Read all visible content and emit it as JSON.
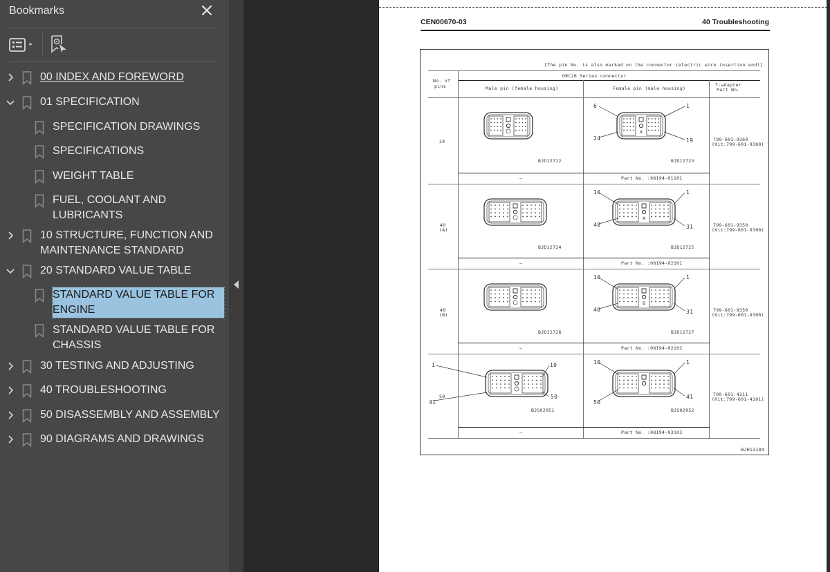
{
  "sidebar": {
    "title": "Bookmarks",
    "close_icon": "close-icon",
    "toolbar": {
      "options_icon": "list-options-icon",
      "find_icon": "find-current-bookmark-icon"
    },
    "items": [
      {
        "label": "00 INDEX AND FOREWORD",
        "level": 0,
        "expanded": false,
        "underline": true
      },
      {
        "label": "01 SPECIFICATION",
        "level": 0,
        "expanded": true
      },
      {
        "label": "SPECIFICATION DRAWINGS",
        "level": 1
      },
      {
        "label": "SPECIFICATIONS",
        "level": 1
      },
      {
        "label": "WEIGHT TABLE",
        "level": 1
      },
      {
        "label": "FUEL, COOLANT AND LUBRICANTS",
        "level": 1
      },
      {
        "label": "10 STRUCTURE, FUNCTION AND MAINTENANCE STANDARD",
        "level": 0,
        "expanded": false
      },
      {
        "label": "20 STANDARD VALUE TABLE",
        "level": 0,
        "expanded": true
      },
      {
        "label": "STANDARD VALUE TABLE FOR ENGINE",
        "level": 1,
        "selected": true
      },
      {
        "label": "STANDARD VALUE TABLE FOR CHASSIS",
        "level": 1
      },
      {
        "label": "30 TESTING AND ADJUSTING",
        "level": 0,
        "expanded": false
      },
      {
        "label": "40 TROUBLESHOOTING",
        "level": 0,
        "expanded": false
      },
      {
        "label": "50 DISASSEMBLY AND ASSEMBLY",
        "level": 0,
        "expanded": false
      },
      {
        "label": "90 DIAGRAMS AND DRAWINGS",
        "level": 0,
        "expanded": false
      }
    ],
    "selection_color": "#9ac3e0"
  },
  "document": {
    "header_left": "CEN00670-03",
    "header_right": "40 Troubleshooting",
    "figure": {
      "note": "[The pin No. is also marked on the connector (electric wire insertion end)]",
      "series_header": "DRC26 Series connector",
      "col_pins": "No. of pins",
      "col_pins_line1": "No. of",
      "col_pins_line2": "pins",
      "col_male": "Male pin (female housing)",
      "col_female": "Female pin (male housing)",
      "col_tadapter_line1": "T-adapter",
      "col_tadapter_line2": "Part No.",
      "figure_id": "BJH13184",
      "rows": [
        {
          "pins": "24",
          "pins_sub": "",
          "male_fig": "BJD12722",
          "female_fig": "BJD12723",
          "male_part": "–",
          "female_part": "Part No. :08194-01101",
          "tadapter": "799-601-9360",
          "kit": "(Kit:799-601-9300)",
          "female_labels": [
            "6",
            "1",
            "24",
            "19"
          ],
          "female_letter": "A",
          "male_labels": []
        },
        {
          "pins": "40",
          "pins_sub": "(A)",
          "male_fig": "BJD12724",
          "female_fig": "BJD12725",
          "male_part": "–",
          "female_part": "Part No. :08194-02101",
          "tadapter": "799-601-9350",
          "kit": "(Kit:799-601-9300)",
          "female_labels": [
            "10",
            "1",
            "40",
            "31"
          ],
          "female_letter": "A",
          "male_labels": []
        },
        {
          "pins": "40",
          "pins_sub": "(B)",
          "male_fig": "BJD12726",
          "female_fig": "BJD12727",
          "male_part": "–",
          "female_part": "Part No. :08194-02102",
          "tadapter": "799-601-9350",
          "kit": "(Kit:799-601-9300)",
          "female_labels": [
            "10",
            "1",
            "40",
            "31"
          ],
          "female_letter": "B",
          "male_labels": []
        },
        {
          "pins": "50",
          "pins_sub": "",
          "male_fig": "BJS02951",
          "female_fig": "BJS02952",
          "male_part": "–",
          "female_part": "Part No. :08194-03103",
          "tadapter": "799-601-4211",
          "kit": "(Kit:799-601-4101)",
          "female_labels": [
            "10",
            "1",
            "50",
            "41"
          ],
          "female_letter": "",
          "male_labels": [
            "1",
            "10",
            "41",
            "50"
          ]
        }
      ]
    }
  }
}
